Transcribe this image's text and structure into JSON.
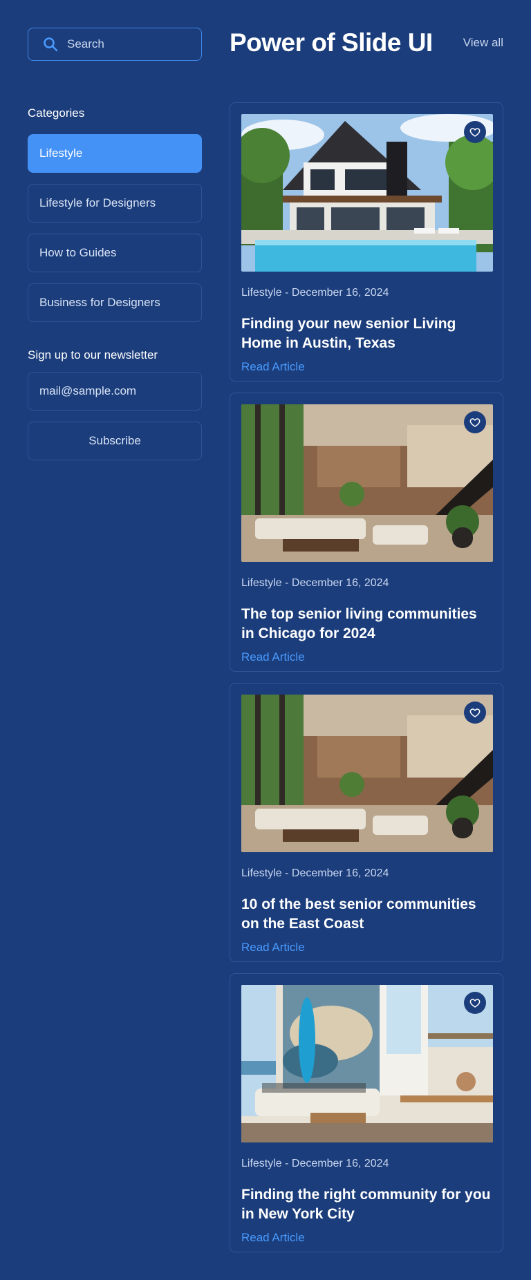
{
  "header": {
    "search_placeholder": "Search",
    "title": "Power of Slide UI",
    "view_all": "View all"
  },
  "sidebar": {
    "categories_label": "Categories",
    "categories": [
      {
        "label": "Lifestyle",
        "active": true
      },
      {
        "label": "Lifestyle for Designers",
        "active": false
      },
      {
        "label": "How to Guides",
        "active": false
      },
      {
        "label": "Business for Designers",
        "active": false
      }
    ],
    "newsletter_label": "Sign up to our newsletter",
    "email_value": "mail@sample.com",
    "subscribe_label": "Subscribe"
  },
  "articles": [
    {
      "meta": "Lifestyle - December 16, 2024",
      "title": "Finding your new senior Living Home in Austin, Texas",
      "link": "Read Article"
    },
    {
      "meta": "Lifestyle - December 16, 2024",
      "title": "The top senior living communities in Chicago for 2024",
      "link": "Read Article"
    },
    {
      "meta": "Lifestyle - December 16, 2024",
      "title": "10 of the best senior communities on the East Coast",
      "link": "Read Article"
    },
    {
      "meta": "Lifestyle - December 16, 2024",
      "title": "Finding the right community for you in New York City",
      "link": "Read Article"
    }
  ],
  "colors": {
    "background": "#1b3d7b",
    "accent": "#4592f7",
    "link": "#4a9bff",
    "border": "#2f5597"
  },
  "icons": [
    "search-icon",
    "heart-icon"
  ]
}
